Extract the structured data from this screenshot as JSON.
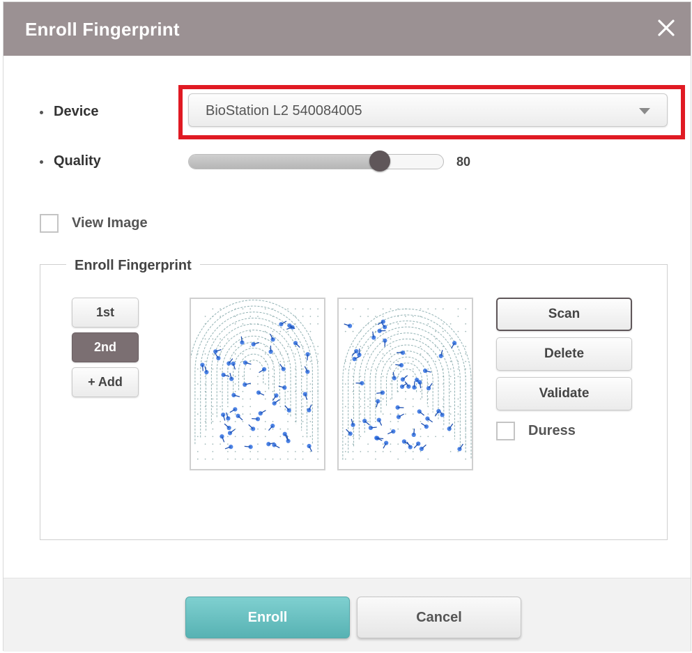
{
  "dialog": {
    "title": "Enroll Fingerprint",
    "close_icon": "close-icon"
  },
  "device": {
    "label": "Device",
    "selected": "BioStation L2 540084005",
    "highlight_color": "#e01a23"
  },
  "quality": {
    "label": "Quality",
    "value": 80,
    "value_text": "80",
    "slider_fraction": 0.75
  },
  "view_image": {
    "label": "View Image",
    "checked": false
  },
  "enroll_group": {
    "legend": "Enroll Fingerprint",
    "templates": [
      {
        "label": "1st",
        "active": false
      },
      {
        "label": "2nd",
        "active": true
      },
      {
        "label": "+ Add",
        "active": false
      }
    ],
    "actions": {
      "scan": "Scan",
      "delete": "Delete",
      "validate": "Validate"
    },
    "duress": {
      "label": "Duress",
      "checked": false
    }
  },
  "footer": {
    "enroll": "Enroll",
    "cancel": "Cancel"
  },
  "colors": {
    "titlebar": "#9b9193",
    "accent": "#57b2b3",
    "active_tab": "#7b6f72",
    "minutiae": "#2f6fe0"
  }
}
